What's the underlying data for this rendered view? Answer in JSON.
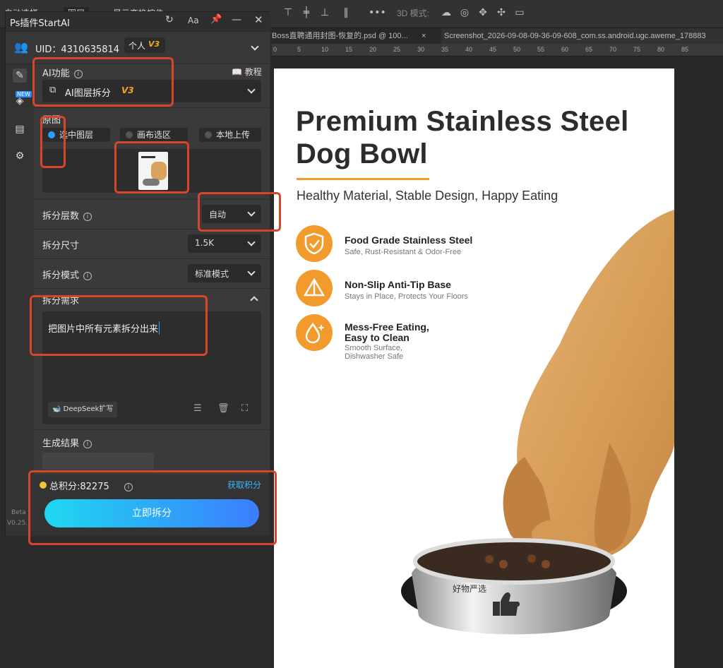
{
  "ps_top": {
    "left_label": "自动选择",
    "layer_select": "图层",
    "show_transform": "显示变换控件",
    "mode_3d": "3D 模式:"
  },
  "tabs": [
    {
      "label": "Boss直聘通用封图-恢复的.psd @ 100..."
    },
    {
      "label": "×"
    },
    {
      "label": "Screenshot_2026-09-08-09-36-09-608_com.ss.android.ugc.aweme_178883"
    }
  ],
  "ruler": [
    "0",
    "5",
    "10",
    "15",
    "20",
    "25",
    "30",
    "35",
    "40",
    "45",
    "50",
    "55",
    "60",
    "65",
    "70",
    "75",
    "80",
    "85"
  ],
  "artboard": {
    "title": "Premium Stainless Steel Dog Bowl",
    "subtitle": "Healthy Material, Stable Design, Happy Eating",
    "features": [
      {
        "title": "Food Grade Stainless Steel",
        "desc": "Safe, Rust-Resistant & Odor-Free"
      },
      {
        "title": "Non-Slip Anti-Tip Base",
        "desc": "Stays in Place, Protects Your Floors"
      },
      {
        "title": "Mess-Free Eating, Easy to Clean",
        "desc": "Smooth Surface, Dishwasher Safe"
      }
    ],
    "bowl_label": "好物严选"
  },
  "panel": {
    "title": "Ps插件StartAI",
    "uid": "UID：4310635814",
    "account": "个人",
    "badge": "V3",
    "new_badge": "NEW",
    "beta": "Beta",
    "version": "V0.25.",
    "ai_function_label": "AI功能",
    "tutorial": "教程",
    "ai_function_value": "AI图层拆分",
    "ai_function_badge": "V3",
    "source_label": "原图",
    "source_opts": [
      "选中图层",
      "画布选区",
      "本地上传"
    ],
    "layers_label": "拆分层数",
    "layers_value": "自动",
    "size_label": "拆分尺寸",
    "size_value": "1.5K",
    "mode_label": "拆分模式",
    "mode_value": "标准模式",
    "need_label": "拆分需求",
    "need_text": "把图片中所有元素拆分出来",
    "deepseek": "DeepSeek扩写",
    "result_label": "生成结果",
    "points": "总积分:82275",
    "get_points": "获取积分",
    "run": "立即拆分"
  }
}
